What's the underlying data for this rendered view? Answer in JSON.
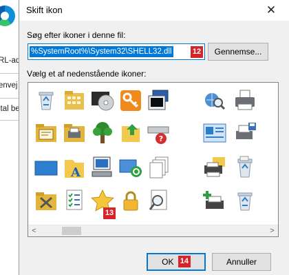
{
  "background": {
    "lines": [
      "RL-ad",
      "envej",
      "ital be"
    ]
  },
  "dialog": {
    "title": "Skift ikon",
    "close_glyph": "✕",
    "search_label": "Søg efter ikoner i denne fil:",
    "file_path": "%SystemRoot%\\System32\\SHELL32.dll",
    "browse_label": "Gennemse...",
    "icons_label": "Vælg et af nedenstående ikoner:",
    "ok_label": "OK",
    "cancel_label": "Annuller"
  },
  "markers": {
    "path": "12",
    "selected_icon": "13",
    "ok": "14"
  },
  "icons": [
    "recycle-bin-empty-icon",
    "folder-grid-icon",
    "dvd-drive-icon",
    "key-icon",
    "monitor-window-icon",
    "network-search-icon",
    "printer-icon",
    "folder-cards-icon",
    "folder-printer-icon",
    "tree-icon",
    "folder-up-arrow-icon",
    "drive-question-icon",
    "control-panel-icon",
    "printer-floppy-icon",
    "blue-screen-icon",
    "folder-font-icon",
    "computer-icon",
    "sync-monitor-icon",
    "documents-stack-icon",
    "printer-folder-icon",
    "recycle-bin-full-icon",
    "folder-tools-icon",
    "checklist-icon",
    "star-icon",
    "padlock-icon",
    "magnifier-document-icon",
    "printer-plus-icon",
    "recycle-bin-icon"
  ],
  "scroll": {
    "left": "<",
    "right": ">"
  },
  "colors": {
    "accent": "#0078d7",
    "marker": "#d6242b"
  }
}
